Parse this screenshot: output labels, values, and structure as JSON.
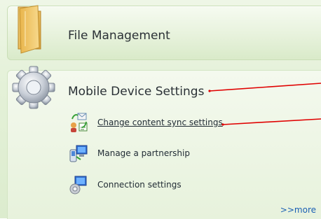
{
  "file_management": {
    "title": "File Management"
  },
  "mobile_device_settings": {
    "title": "Mobile Device Settings",
    "items": [
      {
        "label": "Change content sync settings",
        "icon": "content-sync-icon"
      },
      {
        "label": "Manage a partnership",
        "icon": "partnership-icon"
      },
      {
        "label": "Connection settings",
        "icon": "connection-settings-icon"
      }
    ],
    "more_link": ">>more"
  },
  "colors": {
    "callout_line": "#e00000",
    "link": "#1a5fb4",
    "panel_green": "#e4f1d8"
  }
}
